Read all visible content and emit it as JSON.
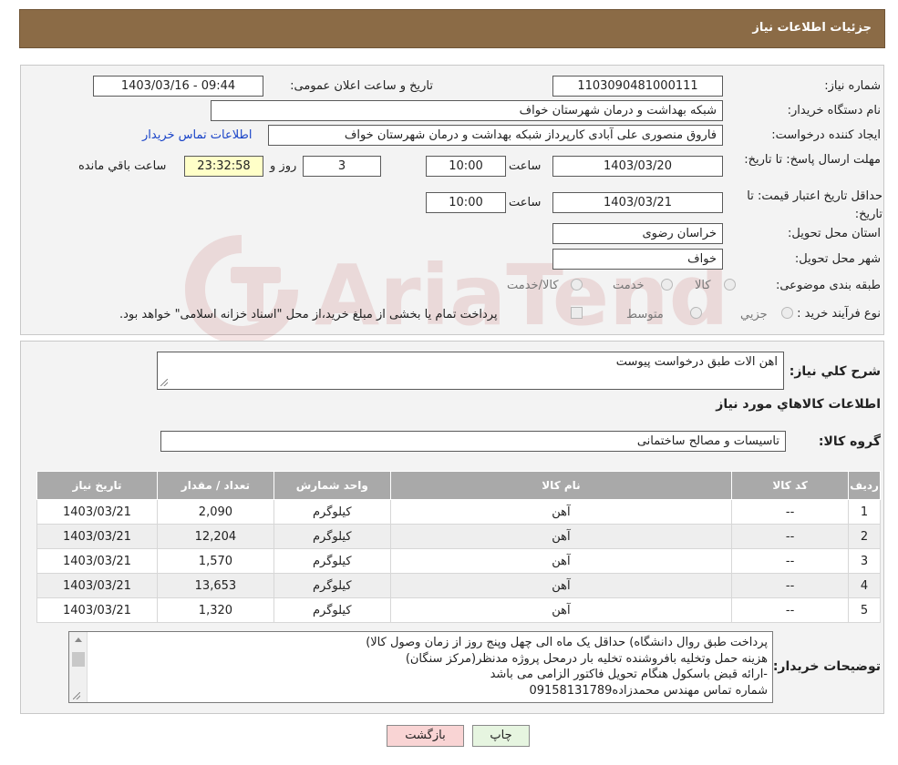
{
  "header": {
    "title": "جزئیات اطلاعات نیاز"
  },
  "labels": {
    "need_number": "شماره نیاز:",
    "announce_datetime": "تاریخ و ساعت اعلان عمومی:",
    "buyer_org": "نام دستگاه خریدار:",
    "requester": "ایجاد کننده درخواست:",
    "reply_deadline": "مهلت ارسال پاسخ: تا تاریخ:",
    "time_word": "ساعت",
    "days_and": "روز و",
    "remaining": "ساعت باقي مانده",
    "price_validity": "حداقل تاریخ اعتبار قیمت: تا تاریخ:",
    "delivery_province": "استان محل تحویل:",
    "delivery_city": "شهر محل تحویل:",
    "category": "طبقه بندی موضوعی:",
    "purchase_process": "نوع فرآیند خرید :",
    "general_desc": "شرح کلي نياز:",
    "items_info": "اطلاعات کالاهاي مورد نياز",
    "goods_group": "گروه کالا:",
    "buyer_notes": "توضیحات خریدار:"
  },
  "values": {
    "need_number": "1103090481000111",
    "announce_datetime": "1403/03/16 - 09:44",
    "buyer_org": "شبکه بهداشت و درمان شهرستان خواف",
    "requester": "فاروق منصوری علی آبادی کارپرداز شبکه بهداشت و درمان شهرستان خواف",
    "contact_link": "اطلاعات تماس خریدار",
    "reply_date": "1403/03/20",
    "reply_time": "10:00",
    "reply_days": "3",
    "reply_remaining": "23:32:58",
    "price_date": "1403/03/21",
    "price_time": "10:00",
    "province": "خراسان رضوی",
    "city": "خواف",
    "general_desc": "اهن الات طبق درخواست پیوست",
    "goods_group": "تاسیسات و مصالح ساختمانی"
  },
  "category_options": [
    "کالا",
    "خدمت",
    "کالا/خدمت"
  ],
  "process_options": [
    "جزیي",
    "متوسط"
  ],
  "process_note": "پرداخت تمام یا بخشی از مبلغ خرید،از محل \"اسناد خزانه اسلامی\" خواهد بود.",
  "table": {
    "headers": [
      "ردیف",
      "کد کالا",
      "نام کالا",
      "واحد شمارش",
      "تعداد / مقدار",
      "تاریخ نیاز"
    ],
    "rows": [
      {
        "row": "1",
        "code": "--",
        "name": "آهن",
        "unit": "کیلوگرم",
        "qty": "2,090",
        "date": "1403/03/21"
      },
      {
        "row": "2",
        "code": "--",
        "name": "آهن",
        "unit": "کیلوگرم",
        "qty": "12,204",
        "date": "1403/03/21"
      },
      {
        "row": "3",
        "code": "--",
        "name": "آهن",
        "unit": "کیلوگرم",
        "qty": "1,570",
        "date": "1403/03/21"
      },
      {
        "row": "4",
        "code": "--",
        "name": "آهن",
        "unit": "کیلوگرم",
        "qty": "13,653",
        "date": "1403/03/21"
      },
      {
        "row": "5",
        "code": "--",
        "name": "آهن",
        "unit": "کیلوگرم",
        "qty": "1,320",
        "date": "1403/03/21"
      }
    ]
  },
  "notes_lines": [
    "پرداخت طبق روال دانشگاه) حداقل یک ماه الی چهل وپنج روز از زمان وصول کالا)",
    "هزینه حمل وتخلیه بافروشنده تخلیه بار درمحل پروژه مدنظر(مرکز سنگان)",
    "-ارائه قبض باسکول هنگام تحویل فاکتور الزامی می باشد",
    "شماره تماس مهندس محمدزاده09158131789"
  ],
  "buttons": {
    "print": "چاپ",
    "back": "بازگشت"
  },
  "watermark": "AriaTender.neT",
  "colors": {
    "header_bg": "#8b6b46",
    "back_btn_bg": "#f9d4d4",
    "print_btn_bg": "#e6f5e0",
    "table_header_bg": "#a9a9a9"
  }
}
